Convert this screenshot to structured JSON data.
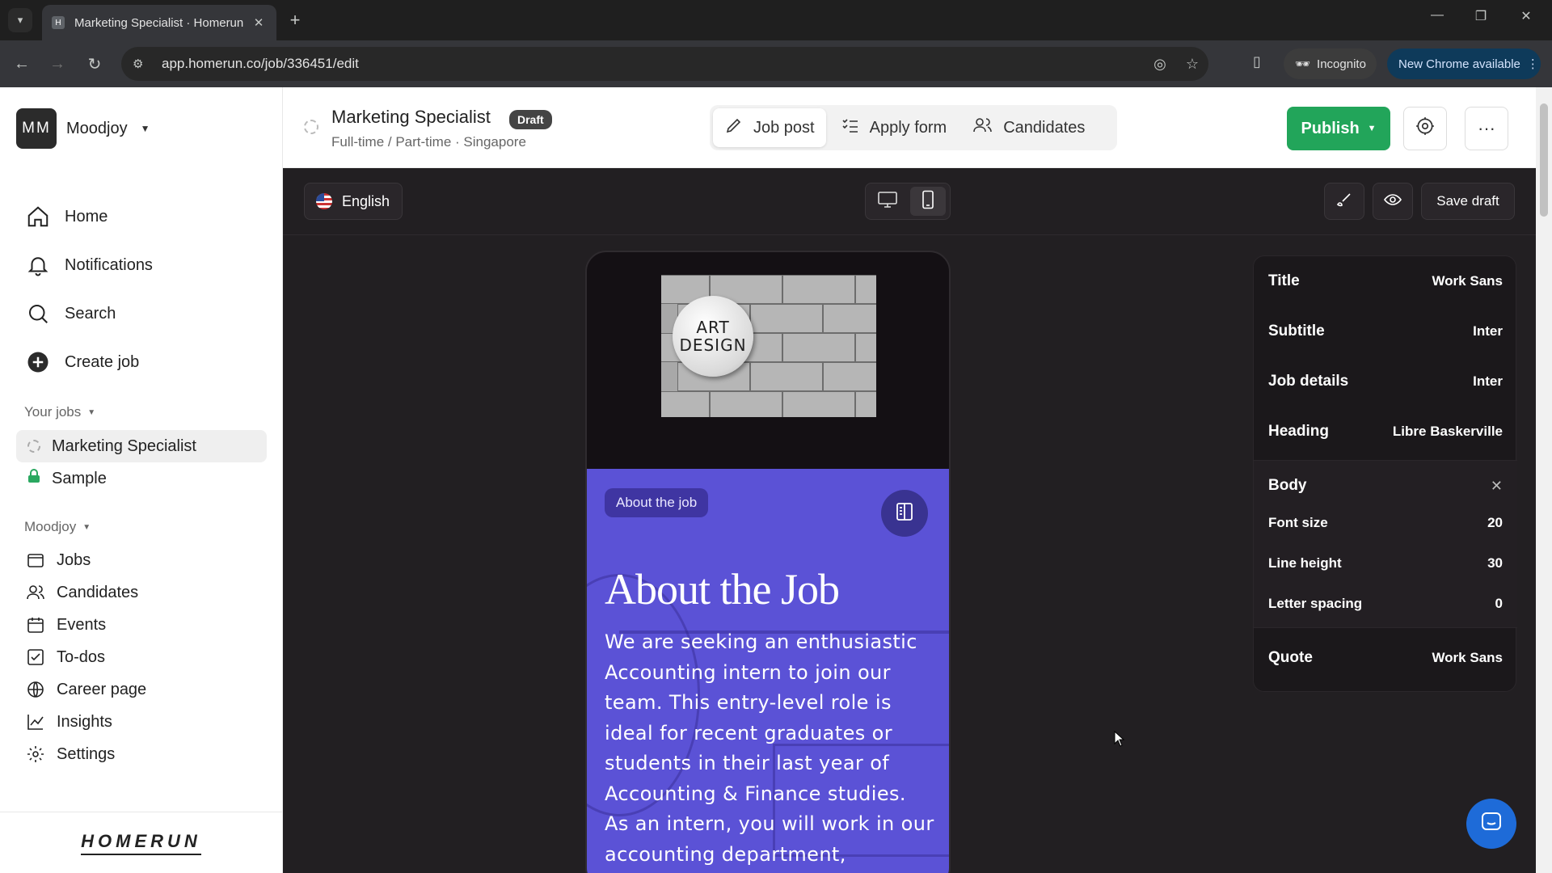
{
  "browser": {
    "tab_title": "Marketing Specialist · Homerun",
    "url": "app.homerun.co/job/336451/edit",
    "incognito_label": "Incognito",
    "new_chrome_label": "New Chrome available"
  },
  "workspace": {
    "initials": "MM",
    "name": "Moodjoy"
  },
  "nav": [
    {
      "label": "Home",
      "icon": "home-icon"
    },
    {
      "label": "Notifications",
      "icon": "bell-icon"
    },
    {
      "label": "Search",
      "icon": "search-icon"
    },
    {
      "label": "Create job",
      "icon": "plus-circle-icon"
    }
  ],
  "your_jobs": {
    "label": "Your jobs",
    "items": [
      {
        "label": "Marketing Specialist",
        "active": true
      },
      {
        "label": "Sample",
        "active": false
      }
    ]
  },
  "moodjoy": {
    "label": "Moodjoy",
    "items": [
      {
        "label": "Jobs",
        "icon": "jobs-icon"
      },
      {
        "label": "Candidates",
        "icon": "candidates-icon"
      },
      {
        "label": "Events",
        "icon": "calendar-icon"
      },
      {
        "label": "To-dos",
        "icon": "checkbox-icon"
      },
      {
        "label": "Career page",
        "icon": "globe-icon"
      },
      {
        "label": "Insights",
        "icon": "chart-icon"
      },
      {
        "label": "Settings",
        "icon": "gear-icon"
      }
    ]
  },
  "footer_brand": "HOMERUN",
  "job": {
    "title": "Marketing Specialist",
    "badge": "Draft",
    "meta": "Full-time / Part-time · Singapore"
  },
  "tabs": [
    {
      "label": "Job post",
      "active": true
    },
    {
      "label": "Apply form",
      "active": false
    },
    {
      "label": "Candidates",
      "active": false
    }
  ],
  "publish_label": "Publish",
  "editor": {
    "language": "English",
    "save_draft": "Save draft"
  },
  "preview": {
    "logo_line1": "ART",
    "logo_line2": "DESIGN",
    "pill": "About the job",
    "heading": "About the Job",
    "body": "We are seeking an enthusiastic Accounting intern to join our team. This entry-level role is ideal for recent graduates or students in their last year of Accounting & Finance studies. As an intern, you will work in our accounting department,"
  },
  "typography": {
    "title": {
      "label": "Title",
      "font": "Work Sans"
    },
    "subtitle": {
      "label": "Subtitle",
      "font": "Inter"
    },
    "job_details": {
      "label": "Job details",
      "font": "Inter"
    },
    "heading": {
      "label": "Heading",
      "font": "Libre Baskerville"
    },
    "body": {
      "label": "Body"
    },
    "font_size": {
      "label": "Font size",
      "value": "20"
    },
    "line_height": {
      "label": "Line height",
      "value": "30"
    },
    "letter_spacing": {
      "label": "Letter spacing",
      "value": "0"
    },
    "quote": {
      "label": "Quote",
      "font": "Work Sans"
    }
  },
  "colors": {
    "accent_green": "#22a55a",
    "preview_purple": "#5b52d6",
    "canvas_bg": "#221f22"
  }
}
